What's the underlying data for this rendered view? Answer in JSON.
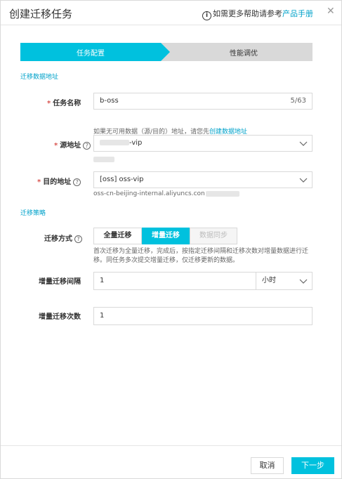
{
  "dialog": {
    "title": "创建迁移任务",
    "help_text": "如需更多帮助请参考",
    "help_link": "产品手册"
  },
  "steps": [
    {
      "label": "任务配置",
      "active": true
    },
    {
      "label": "性能调优",
      "active": false
    }
  ],
  "section_data": "迁移数据地址",
  "section_strategy": "迁移策略",
  "fields": {
    "task_name": {
      "label": "任务名称",
      "value": "b-oss",
      "counter": "5/63"
    },
    "source": {
      "label": "源地址",
      "hint_prefix": "如果无可用数据（源/目的）地址，请您先",
      "hint_link": "创建数据地址",
      "value_suffix": "-vip"
    },
    "dest": {
      "label": "目的地址",
      "value": "[oss] oss-vip",
      "endpoint": "oss-cn-beijing-internal.aliyuncs.con"
    },
    "mode": {
      "label": "迁移方式",
      "options": [
        "全量迁移",
        "增量迁移",
        "数据同步"
      ],
      "selected": "增量迁移",
      "description": "首次迁移为全量迁移，完成后，按指定迁移间隔和迁移次数对增量数据进行迁移。同任务多次提交增量迁移，仅迁移更新的数据。"
    },
    "interval": {
      "label": "增量迁移间隔",
      "value": "1",
      "unit": "小时"
    },
    "count": {
      "label": "增量迁移次数",
      "value": "1"
    }
  },
  "buttons": {
    "cancel": "取消",
    "next": "下一步"
  },
  "colors": {
    "accent": "#00c1de",
    "link": "#00a2ca",
    "required": "#d9534f"
  }
}
